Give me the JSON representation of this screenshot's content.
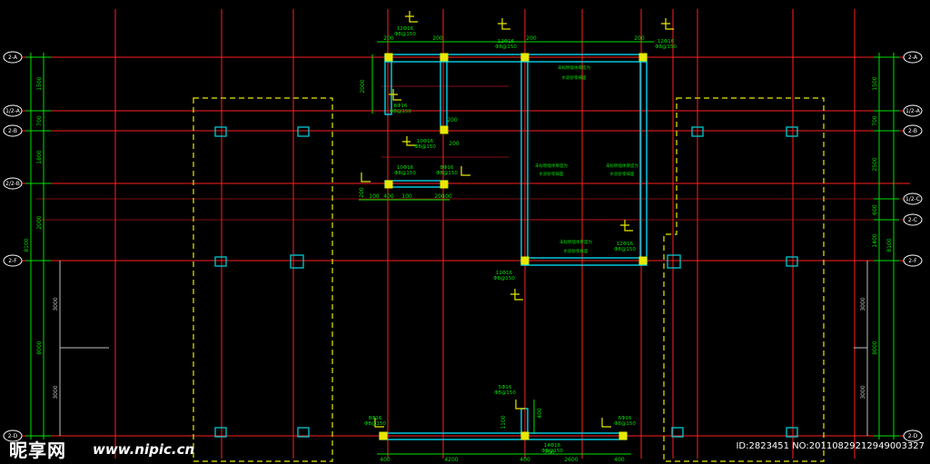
{
  "axes": {
    "labels_left": [
      "2-A",
      "1/2-A",
      "2-B",
      "2/2-B",
      "2-F",
      "2-D"
    ],
    "labels_right": [
      "2-A",
      "1/2-A",
      "2-B",
      "1/2-C",
      "2-C",
      "2-F",
      "2-D"
    ]
  },
  "dims": {
    "left_chain": [
      "1500",
      "700",
      "1800",
      "2000",
      "3000",
      "3000"
    ],
    "left_overall": [
      "8000",
      "8100",
      "3000"
    ],
    "right_chain": [
      "1500",
      "700",
      "2500",
      "600",
      "1400",
      "3000",
      "3000"
    ],
    "right_overall": [
      "8100",
      "8000"
    ],
    "bottom": [
      "400",
      "4200",
      "400",
      "2600",
      "400"
    ],
    "top_small": [
      "200",
      "200",
      "200",
      "200",
      "200",
      "200"
    ],
    "misc": [
      "2000",
      "100",
      "400",
      "100",
      "200",
      "100",
      "200",
      "1100",
      "200",
      "400"
    ]
  },
  "rebar_notes": [
    {
      "id": "12Φ16",
      "spec": "Φ8@150"
    },
    {
      "id": "12Φ16",
      "spec": "Φ8@150"
    },
    {
      "id": "12Φ16",
      "spec": "Φ8@150"
    },
    {
      "id": "6Φ16",
      "spec": "Φ8@150"
    },
    {
      "id": "10Φ16",
      "spec": "Φ8@150"
    },
    {
      "id": "10Φ16",
      "spec": "Φ8@150"
    },
    {
      "id": "8Φ16",
      "spec": "Φ8@150"
    },
    {
      "id": "12Φ16",
      "spec": "Φ8@150"
    },
    {
      "id": "12Φ16",
      "spec": "Φ8@150"
    },
    {
      "id": "5Φ16",
      "spec": "Φ8@150"
    },
    {
      "id": "8Φ16",
      "spec": "Φ8@150"
    },
    {
      "id": "6Φ16",
      "spec": "Φ8@150"
    },
    {
      "id": "14Φ16",
      "spec": "Φ8@150"
    }
  ],
  "wall_notes": {
    "line1": "未标明墙体厚度为",
    "line2": "水泥砂浆抹面"
  },
  "watermark": {
    "logo": "昵享网",
    "url": "www.nipic.cn",
    "id": "ID:2823451 NO:20110829212949003327"
  },
  "colors": {
    "background": "#000000",
    "grid": "#ff2020",
    "dimension": "#00e000",
    "wall": "#00e5ff",
    "dashed": "#e8e800",
    "column": "#00c8d0",
    "text": "#ffffff"
  }
}
